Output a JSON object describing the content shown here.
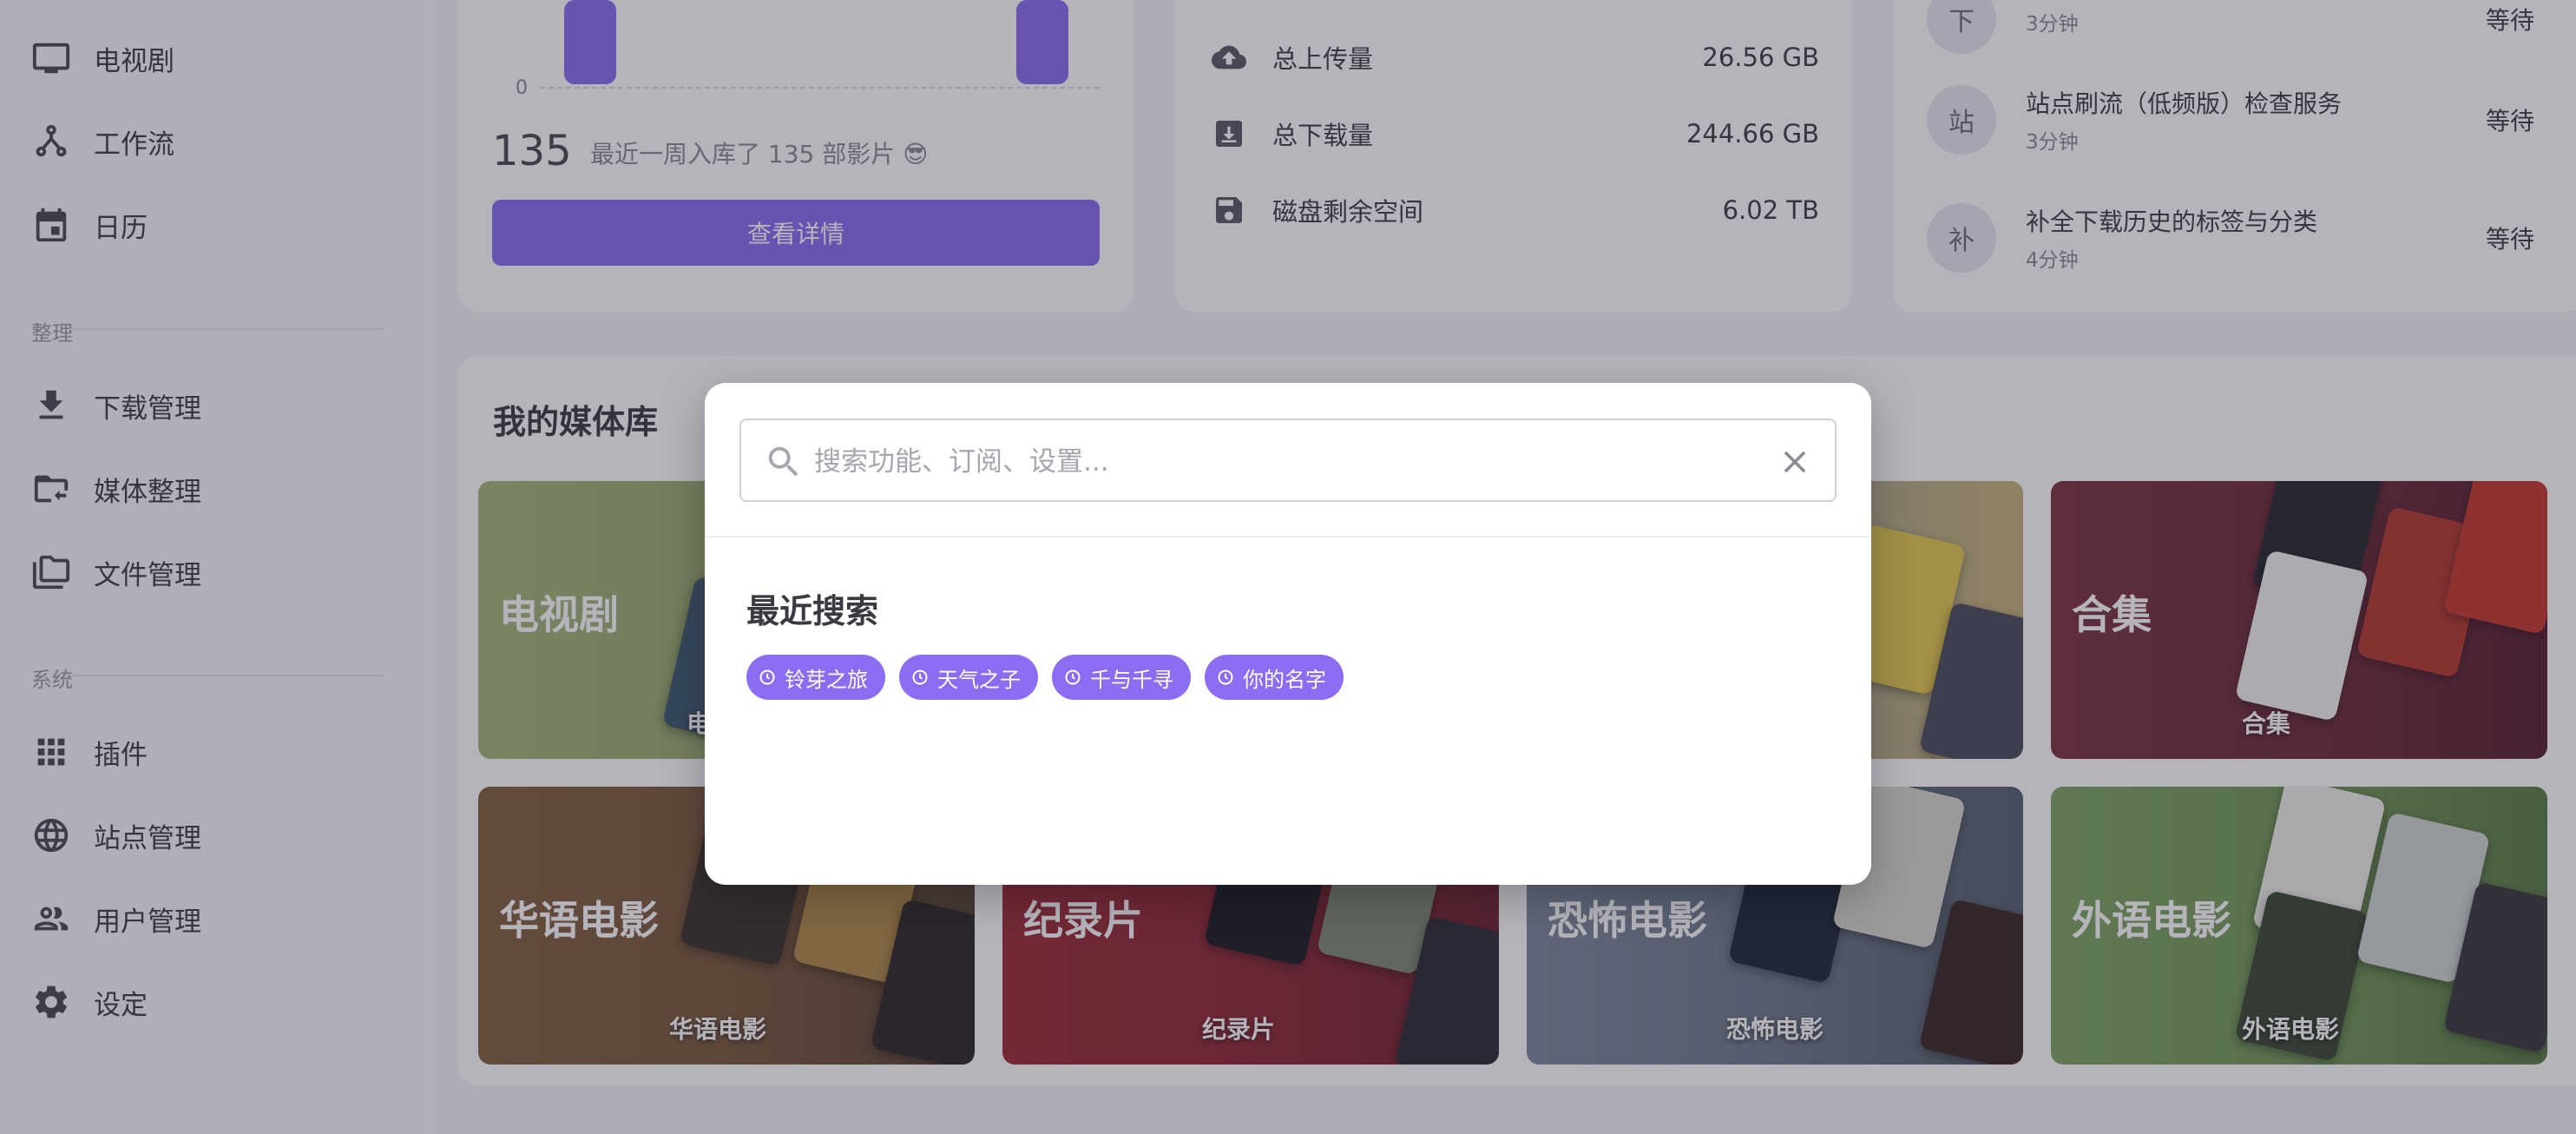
{
  "sidebar": {
    "items": [
      {
        "label": "电视剧",
        "icon": "tv-icon"
      },
      {
        "label": "工作流",
        "icon": "workflow-icon"
      },
      {
        "label": "日历",
        "icon": "calendar-icon"
      }
    ],
    "sections": [
      {
        "title": "整理",
        "items": [
          {
            "label": "下载管理",
            "icon": "download-icon"
          },
          {
            "label": "媒体整理",
            "icon": "folder-move-icon"
          },
          {
            "label": "文件管理",
            "icon": "folders-icon"
          }
        ]
      },
      {
        "title": "系统",
        "items": [
          {
            "label": "插件",
            "icon": "apps-grid-icon"
          },
          {
            "label": "站点管理",
            "icon": "globe-icon"
          },
          {
            "label": "用户管理",
            "icon": "users-icon"
          },
          {
            "label": "设定",
            "icon": "gear-icon"
          }
        ]
      }
    ]
  },
  "weekly": {
    "axis_zero": "0",
    "count": "135",
    "summary": "最近一周入库了 135 部影片 😎",
    "details_button": "查看详情"
  },
  "storage": {
    "rows": [
      {
        "label": "总上传量",
        "value": "26.56 GB",
        "icon": "cloud-upload-icon"
      },
      {
        "label": "总下载量",
        "value": "244.66 GB",
        "icon": "download-box-icon"
      },
      {
        "label": "磁盘剩余空间",
        "value": "6.02 TB",
        "icon": "save-icon"
      }
    ]
  },
  "tasks": {
    "rows": [
      {
        "avatar": "下",
        "name": "",
        "time": "3分钟",
        "status": "等待"
      },
      {
        "avatar": "站",
        "name": "站点刷流（低频版）检查服务",
        "time": "3分钟",
        "status": "等待"
      },
      {
        "avatar": "补",
        "name": "补全下载历史的标签与分类",
        "time": "4分钟",
        "status": "等待"
      }
    ]
  },
  "library": {
    "title": "我的媒体库",
    "tiles": [
      {
        "name": "电视剧",
        "sub": "电",
        "color": "#a5b77a"
      },
      {
        "name": "",
        "sub": "",
        "color": "#6a7c8c"
      },
      {
        "name": "",
        "sub": "",
        "color": "#8a9aa8"
      },
      {
        "name": "合集",
        "sub": "合集",
        "color": "#7b3440"
      },
      {
        "name": "华语电影",
        "sub": "华语电影",
        "color": "#83613f"
      },
      {
        "name": "纪录片",
        "sub": "纪录片",
        "color": "#9c2c36"
      },
      {
        "name": "恐怖电影",
        "sub": "恐怖电影",
        "color": "#7d8a99"
      },
      {
        "name": "外语电影",
        "sub": "外语电影",
        "color": "#7ea662"
      }
    ]
  },
  "search": {
    "placeholder": "搜索功能、订阅、设置...",
    "value": "",
    "recent_title": "最近搜索",
    "recent": [
      "铃芽之旅",
      "天气之子",
      "千与千寻",
      "你的名字"
    ]
  },
  "colors": {
    "accent": "#8c6cf0",
    "overlay": "rgba(38,36,56,0.34)"
  }
}
